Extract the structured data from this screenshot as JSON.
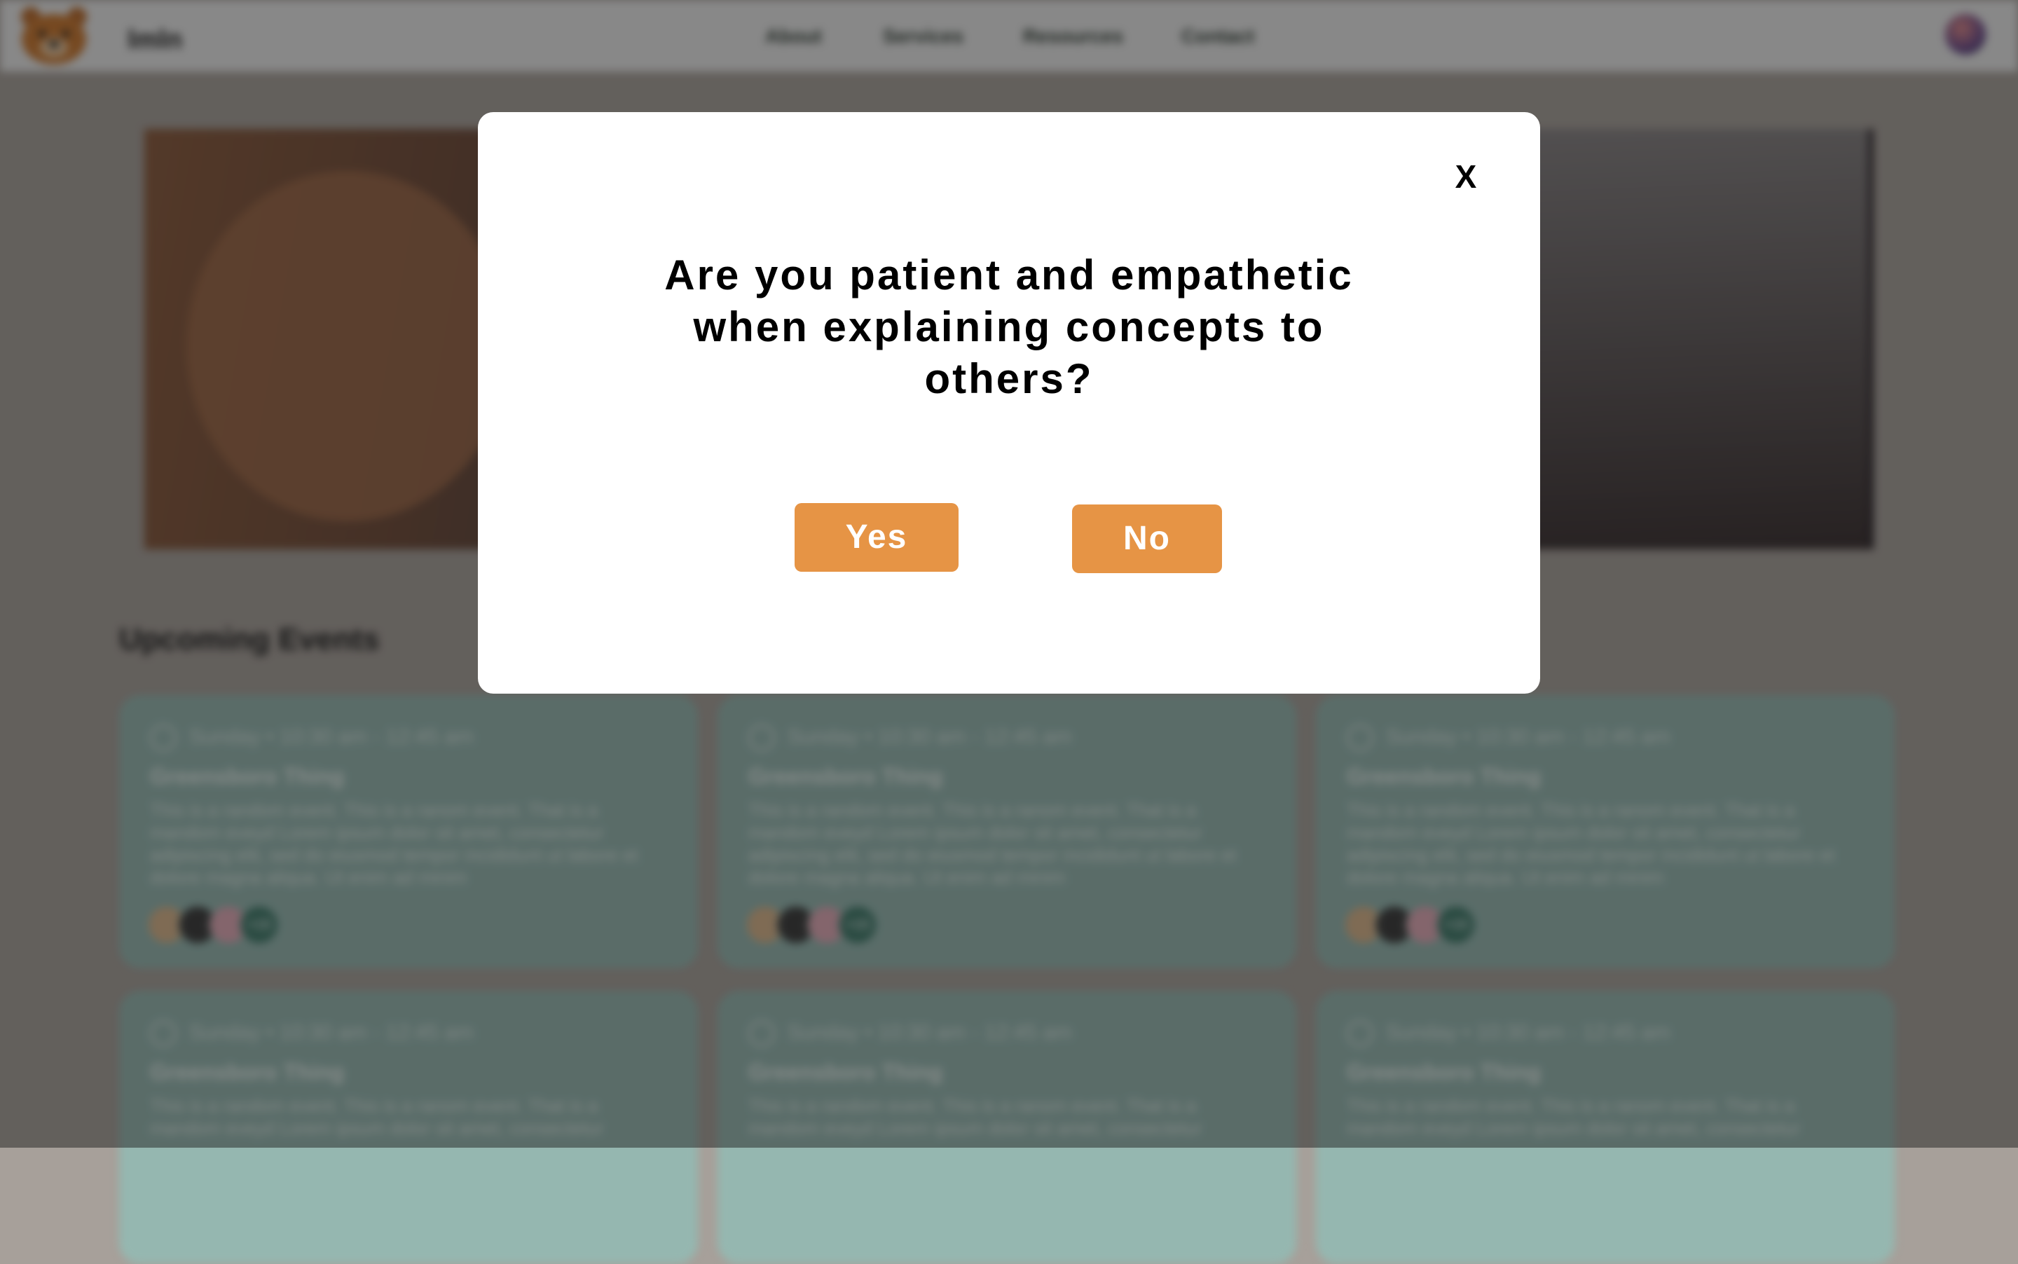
{
  "header": {
    "brand": "lmln",
    "nav": [
      "About",
      "Services",
      "Resources",
      "Contact"
    ]
  },
  "events": {
    "title": "Upcoming Events",
    "cards": [
      {
        "time": "Sunday • 10:30 am - 12:45 am",
        "title": "Greensboro Thing",
        "desc": "This is a random event. This is a ranom event. That is a mandom eveyd Lorem ipsum dolor sit amet, consectetur adipiscing elit, sed do eiusmod tempor incididunt ut labore et dolore magna aliqua. Ut enim ad minim",
        "extra": "+15"
      },
      {
        "time": "Sunday • 10:30 am - 12:45 am",
        "title": "Greensboro Thing",
        "desc": "This is a random event. This is a ranom event. That is a mandom eveyd Lorem ipsum dolor sit amet, consectetur adipiscing elit, sed do eiusmod tempor incididunt ut labore et dolore magna aliqua. Ut enim ad minim",
        "extra": "+15"
      },
      {
        "time": "Sunday • 10:30 am - 12:45 am",
        "title": "Greensboro Thing",
        "desc": "This is a random event. This is a ranom event. That is a mandom eveyd Lorem ipsum dolor sit amet, consectetur adipiscing elit, sed do eiusmod tempor incididunt ut labore et dolore magna aliqua. Ut enim ad minim",
        "extra": "+15"
      },
      {
        "time": "Sunday • 10:30 am - 12:45 am",
        "title": "Greensboro Thing",
        "desc": "This is a random event. This is a ranom event. That is a mandom eveyd Lorem ipsum dolor sit amet, consectetur"
      },
      {
        "time": "Sunday • 10:30 am - 12:45 am",
        "title": "Greensboro Thing",
        "desc": "This is a random event. This is a ranom event. That is a mandom eveyd Lorem ipsum dolor sit amet, consectetur"
      },
      {
        "time": "Sunday • 10:30 am - 12:45 am",
        "title": "Greensboro Thing",
        "desc": "This is a random event. This is a ranom event. That is a mandom eveyd Lorem ipsum dolor sit amet, consectetur"
      }
    ]
  },
  "modal": {
    "close_label": "X",
    "question": "Are you patient and empathetic when explaining concepts to others?",
    "yes_label": "Yes",
    "no_label": "No"
  },
  "colors": {
    "accent": "#e69445",
    "card": "#95b7b0",
    "overlay": "rgba(18,18,18,0.45)"
  },
  "icons": [
    "bear-logo-icon",
    "user-avatar-icon",
    "clock-icon",
    "close-icon"
  ]
}
